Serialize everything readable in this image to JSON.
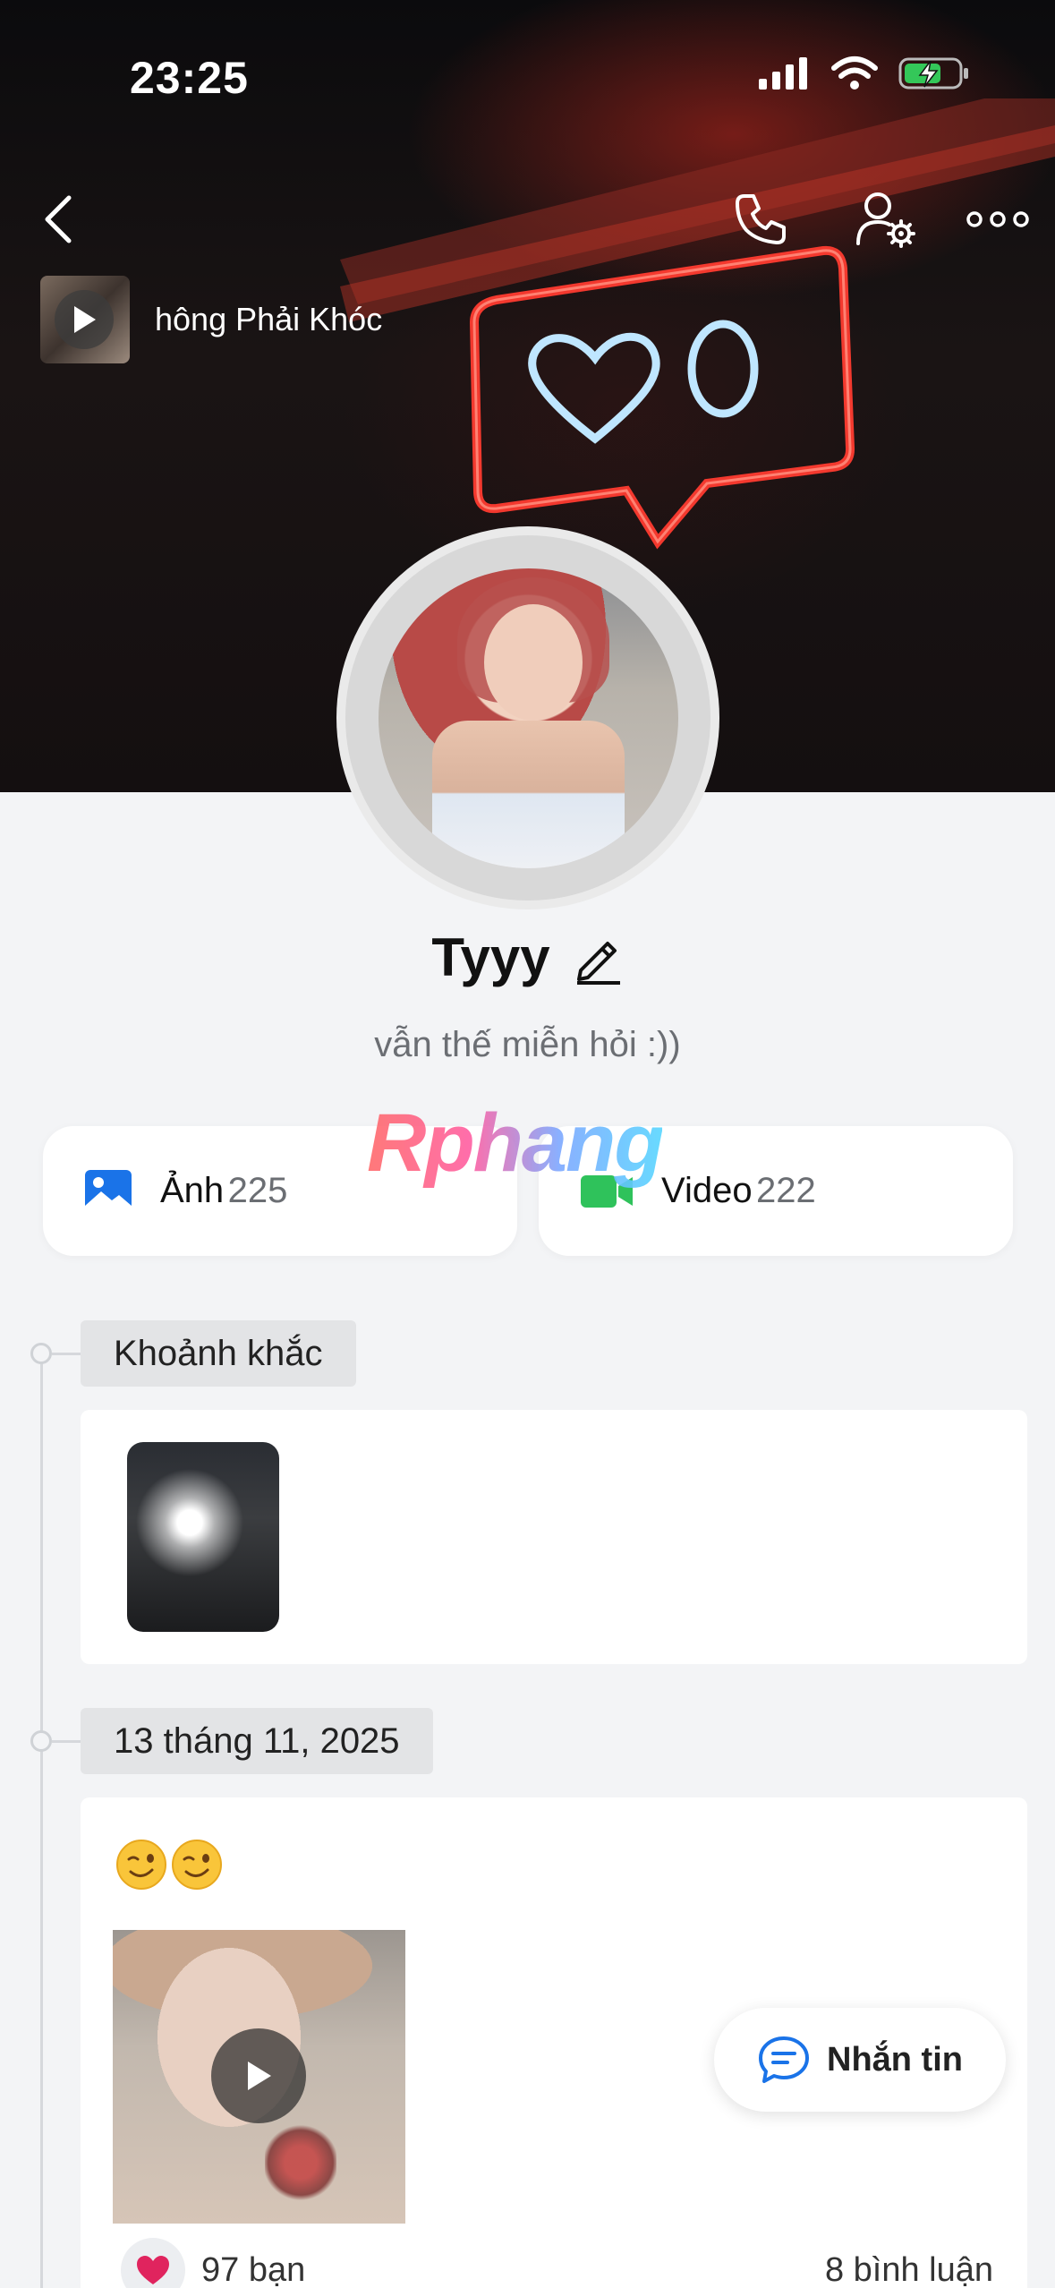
{
  "status_bar": {
    "time": "23:25"
  },
  "cover": {
    "music_title": "hông Phải Khóc"
  },
  "profile": {
    "name": "Tyyy",
    "status": "vẫn thế miễn hỏi :))"
  },
  "watermark": "Rphang",
  "media": {
    "photos": {
      "label": "Ảnh",
      "count": "225"
    },
    "videos": {
      "label": "Video",
      "count": "222"
    }
  },
  "timeline": {
    "moments_label": "Khoảnh khắc",
    "post_date": "13 tháng 11, 2025",
    "post": {
      "text": "😉😉",
      "reactions": "97 bạn",
      "comments": "8 bình luận"
    }
  },
  "message_button": {
    "label": "Nhắn tin"
  },
  "colors": {
    "accent_blue": "#1a73e8",
    "video_green": "#2fc25b",
    "reaction_red": "#e0245e",
    "neon_red": "#ff3b2f",
    "neon_blue": "#bfe6ff"
  },
  "icons": {
    "back": "chevron-left-icon",
    "call": "phone-icon",
    "settings": "user-settings-icon",
    "more": "more-icon",
    "edit": "pencil-icon",
    "photos": "image-icon",
    "videos": "video-camera-icon",
    "reaction": "heart-icon",
    "message": "chat-bubble-icon"
  }
}
